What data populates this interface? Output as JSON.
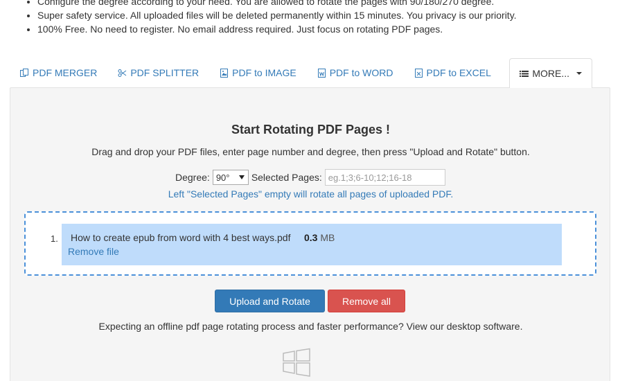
{
  "bullets": [
    "Configure the degree according to your need. You are allowed to rotate the pages with 90/180/270 degree.",
    "Super safety service. All uploaded files will be deleted permanently within 15 minutes. You privacy is our priority.",
    "100% Free. No need to register. No email address required. Just focus on rotating PDF pages."
  ],
  "tabs": {
    "merger": "PDF MERGER",
    "splitter": "PDF SPLITTER",
    "image": "PDF to IMAGE",
    "word": "PDF to WORD",
    "excel": "PDF to EXCEL",
    "more": "MORE..."
  },
  "main": {
    "title": "Start Rotating PDF Pages !",
    "description": "Drag and drop your PDF files, enter page number and degree, then press \"Upload and Rotate\" button.",
    "degree_label": "Degree:",
    "degree_value": "90°",
    "pages_label": "Selected Pages:",
    "pages_placeholder": "eg.1;3;6-10;12;16-18",
    "hint": "Left \"Selected Pages\" empty will rotate all pages of uploaded PDF.",
    "file": {
      "index": "1.",
      "name": "How to create epub from word with 4 best ways.pdf",
      "size_value": "0.3",
      "size_unit": "MB",
      "remove_label": "Remove file"
    },
    "upload_button": "Upload and Rotate",
    "remove_all_button": "Remove all",
    "offline_text": "Expecting an offline pdf page rotating process and faster performance? View our desktop software."
  },
  "colors": {
    "link": "#337ab7",
    "primary": "#337ab7",
    "danger": "#d9534f",
    "file_row": "#bfdcfb",
    "dropzone_border": "#4a90d9"
  },
  "icons": [
    "merge-icon",
    "scissors-icon",
    "image-icon",
    "word-icon",
    "excel-icon",
    "list-icon",
    "windows-icon"
  ]
}
